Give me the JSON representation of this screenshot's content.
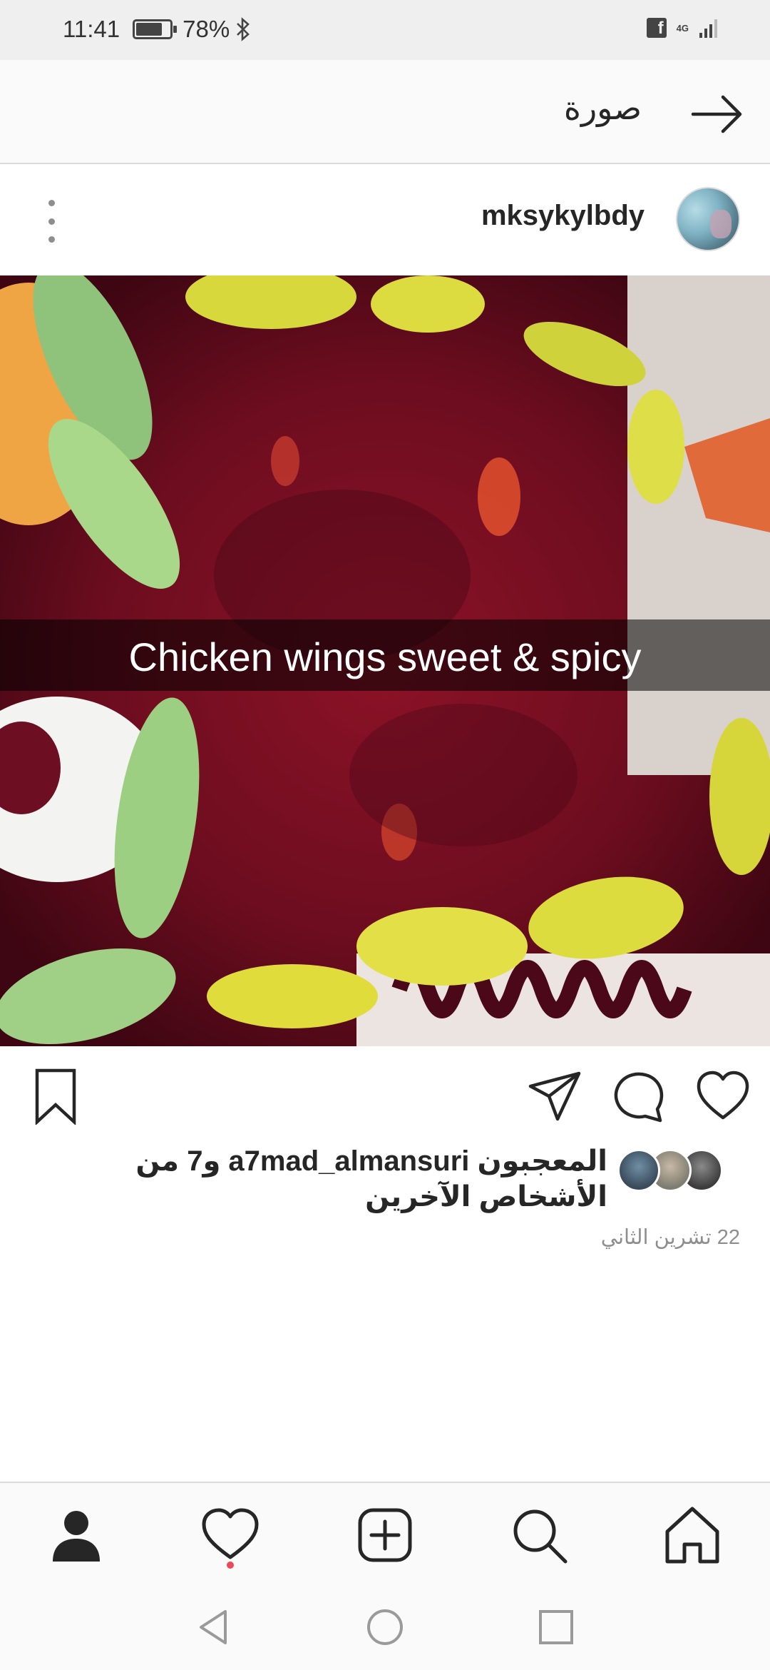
{
  "status_bar": {
    "time": "11:41",
    "battery": "78%",
    "battery_level": 0.78,
    "network": "4G"
  },
  "header": {
    "title": "صورة"
  },
  "post": {
    "username": "mksykylbdy",
    "caption_overlay": "Chicken wings sweet & spicy",
    "likes_text": "المعجبون a7mad_almansuri و7 من الأشخاص الآخرين",
    "date": "22 تشرين الثاني"
  },
  "icons": {
    "back": "arrow-right-icon",
    "more": "more-vertical-icon",
    "like": "heart-icon",
    "comment": "comment-icon",
    "share": "send-icon",
    "save": "bookmark-icon",
    "nav": [
      "profile-icon",
      "activity-heart-icon",
      "add-post-icon",
      "search-icon",
      "home-icon"
    ],
    "system": [
      "back-triangle-icon",
      "home-circle-icon",
      "recents-square-icon"
    ]
  },
  "colors": {
    "notification": "#ed4956",
    "text_primary": "#262626",
    "text_secondary": "#8e8e8e"
  }
}
